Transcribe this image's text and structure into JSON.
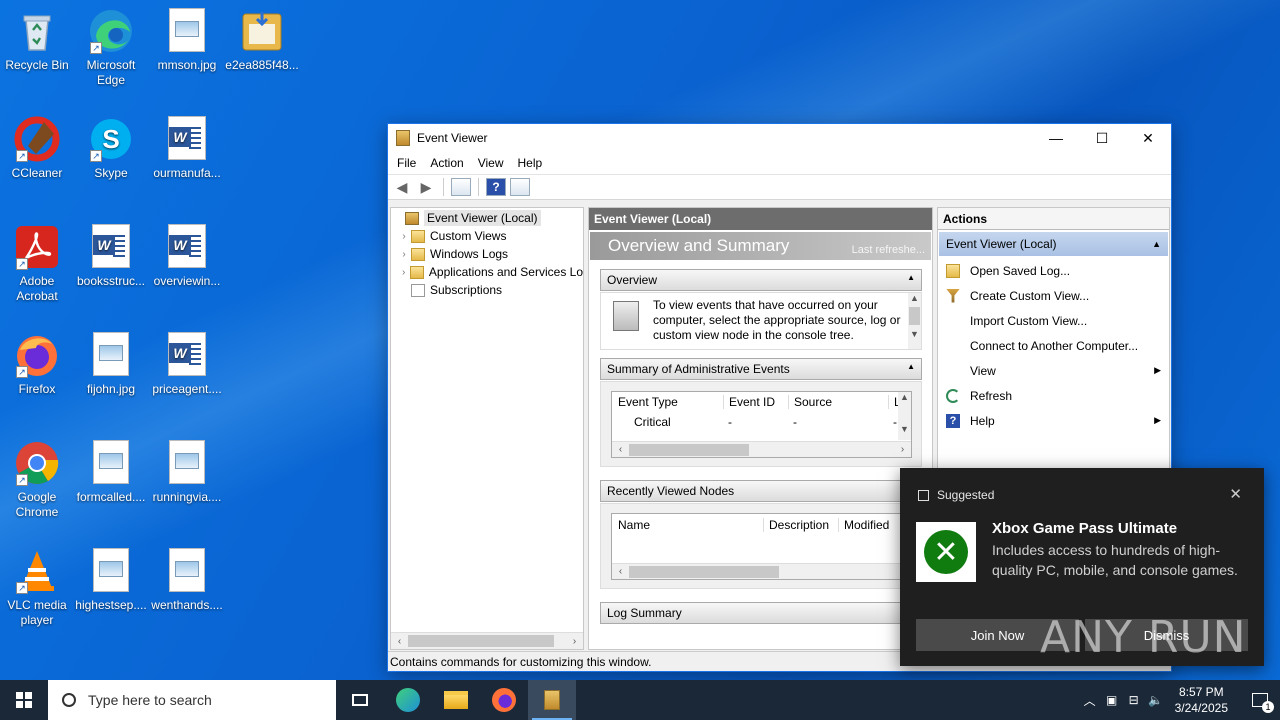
{
  "desktop": {
    "icons": [
      {
        "label": "Recycle Bin",
        "icon": "recycle-bin-icon"
      },
      {
        "label": "Microsoft Edge",
        "icon": "edge-icon"
      },
      {
        "label": "mmson.jpg",
        "icon": "image-file-icon"
      },
      {
        "label": "e2ea885f48...",
        "icon": "installer-icon"
      },
      {
        "label": "CCleaner",
        "icon": "ccleaner-icon"
      },
      {
        "label": "Skype",
        "icon": "skype-icon"
      },
      {
        "label": "ourmanufa...",
        "icon": "word-doc-icon"
      },
      {
        "label": "Adobe Acrobat",
        "icon": "acrobat-icon"
      },
      {
        "label": "booksstruc...",
        "icon": "word-doc-icon"
      },
      {
        "label": "overviewin...",
        "icon": "word-doc-icon"
      },
      {
        "label": "Firefox",
        "icon": "firefox-icon"
      },
      {
        "label": "fijohn.jpg",
        "icon": "image-file-icon"
      },
      {
        "label": "priceagent....",
        "icon": "word-doc-icon"
      },
      {
        "label": "Google Chrome",
        "icon": "chrome-icon"
      },
      {
        "label": "formcalled....",
        "icon": "image-file-icon"
      },
      {
        "label": "runningvia....",
        "icon": "image-file-icon"
      },
      {
        "label": "VLC media player",
        "icon": "vlc-icon"
      },
      {
        "label": "highestsep....",
        "icon": "image-file-icon"
      },
      {
        "label": "wenthands....",
        "icon": "image-file-icon"
      }
    ]
  },
  "window": {
    "title": "Event Viewer",
    "menu": [
      "File",
      "Action",
      "View",
      "Help"
    ],
    "tree": {
      "root": "Event Viewer (Local)",
      "items": [
        "Custom Views",
        "Windows Logs",
        "Applications and Services Lo",
        "Subscriptions"
      ]
    },
    "center": {
      "header": "Event Viewer (Local)",
      "banner_title": "Overview and Summary",
      "banner_right": "Last refreshe...",
      "overview_title": "Overview",
      "overview_text": "To view events that have occurred on your computer, select the appropriate source, log or custom view node in the console tree.",
      "summary_title": "Summary of Administrative Events",
      "summary_columns": [
        "Event Type",
        "Event ID",
        "Source",
        "L"
      ],
      "summary_row": [
        "Critical",
        "-",
        "-",
        "-"
      ],
      "recent_title": "Recently Viewed Nodes",
      "recent_columns": [
        "Name",
        "Description",
        "Modified"
      ],
      "log_summary_title": "Log Summary"
    },
    "actions": {
      "header": "Actions",
      "sub_header": "Event Viewer (Local)",
      "items": [
        {
          "label": "Open Saved Log...",
          "icon": "folder-open-icon"
        },
        {
          "label": "Create Custom View...",
          "icon": "filter-icon"
        },
        {
          "label": "Import Custom View...",
          "icon": ""
        },
        {
          "label": "Connect to Another Computer...",
          "icon": ""
        },
        {
          "label": "View",
          "icon": ""
        },
        {
          "label": "Refresh",
          "icon": "refresh-icon"
        },
        {
          "label": "Help",
          "icon": "help-icon"
        }
      ]
    },
    "status": "Contains commands for customizing this window."
  },
  "toast": {
    "header": "Suggested",
    "title": "Xbox Game Pass Ultimate",
    "body": "Includes access to hundreds of high-quality PC, mobile, and console games.",
    "primary": "Join Now",
    "secondary": "Dismiss"
  },
  "watermark": "ANY RUN",
  "taskbar": {
    "search_placeholder": "Type here to search",
    "time": "8:57 PM",
    "date": "3/24/2025",
    "notification_count": "1"
  }
}
